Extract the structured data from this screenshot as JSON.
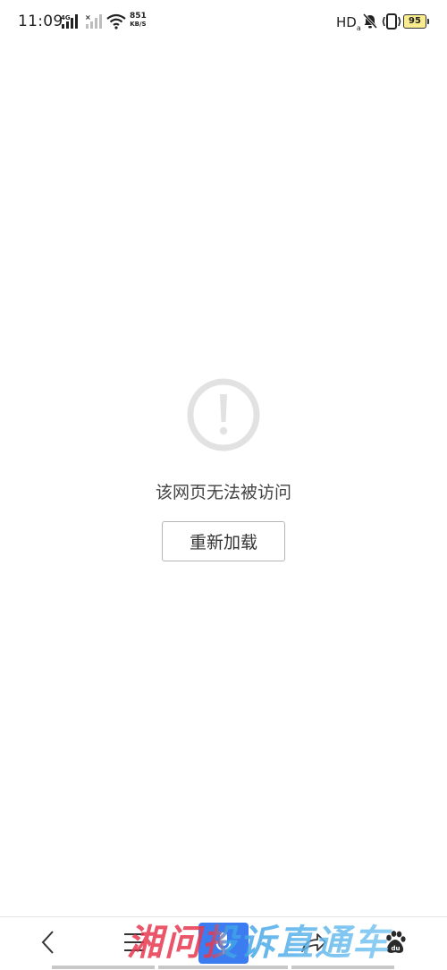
{
  "status_bar": {
    "time": "11:09",
    "network_type": "4G",
    "speed_value": "851",
    "speed_unit": "KB/S",
    "hd_label": "HD",
    "battery_level": "95",
    "battery_color": "#f8ec8f"
  },
  "error_page": {
    "icon": "exclamation-circle-icon",
    "message": "该网页无法被访问",
    "reload_label": "重新加载",
    "icon_color": "#e2e2e2"
  },
  "toolbar": {
    "items": [
      {
        "icon": "back-icon"
      },
      {
        "icon": "menu-icon"
      },
      {
        "icon": "microphone-icon"
      },
      {
        "icon": "share-icon"
      },
      {
        "icon": "baidu-paw-icon"
      }
    ],
    "voice_color": "#3b7cf0"
  },
  "watermark": {
    "text": "湘问投诉直通车"
  }
}
